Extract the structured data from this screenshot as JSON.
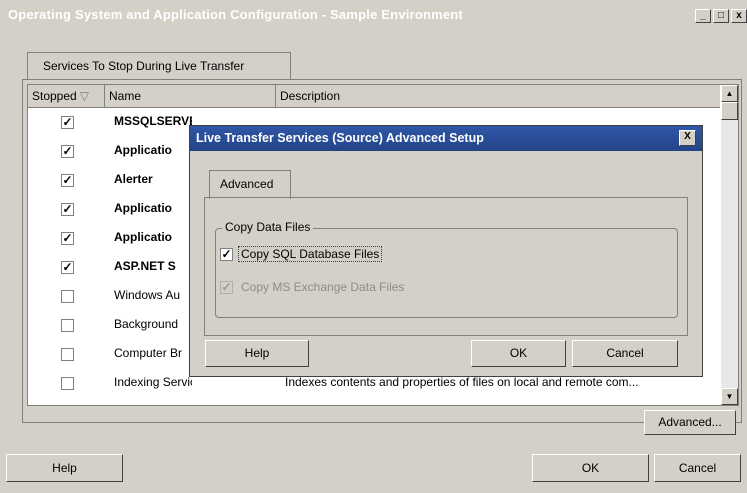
{
  "window": {
    "title": "Operating System and Application Configuration - Sample Environment",
    "controls": [
      "_",
      "□",
      "x"
    ]
  },
  "tab": {
    "label": "Services To Stop During Live Transfer"
  },
  "list": {
    "columns": {
      "stopped": "Stopped",
      "name": "Name",
      "description": "Description"
    },
    "rows": [
      {
        "checked": true,
        "name": "MSSQLSERVER",
        "description": ""
      },
      {
        "checked": true,
        "name": "Applicatio",
        "description": ""
      },
      {
        "checked": true,
        "name": "Alerter",
        "description": ""
      },
      {
        "checked": true,
        "name": "Applicatio",
        "description": ""
      },
      {
        "checked": true,
        "name": "Applicatio",
        "description": ""
      },
      {
        "checked": true,
        "name": "ASP.NET S",
        "description": ""
      },
      {
        "checked": false,
        "name": "Windows Au",
        "description": ""
      },
      {
        "checked": false,
        "name": "Background",
        "description": ""
      },
      {
        "checked": false,
        "name": "Computer Br",
        "description": ""
      },
      {
        "checked": false,
        "name": "Indexing Service",
        "description": "Indexes contents and properties of files on local and remote com..."
      }
    ]
  },
  "buttons": {
    "advanced": "Advanced...",
    "help": "Help",
    "ok": "OK",
    "cancel": "Cancel"
  },
  "dialog": {
    "title": "Live Transfer Services (Source) Advanced Setup",
    "close": "X",
    "tab": "Advanced",
    "group_label": "Copy Data Files",
    "copy_sql": {
      "label": "Copy SQL Database Files",
      "checked": true
    },
    "copy_exchange": {
      "label": "Copy MS Exchange Data Files",
      "checked": true,
      "disabled": true
    },
    "help": "Help",
    "ok": "OK",
    "cancel": "Cancel"
  }
}
